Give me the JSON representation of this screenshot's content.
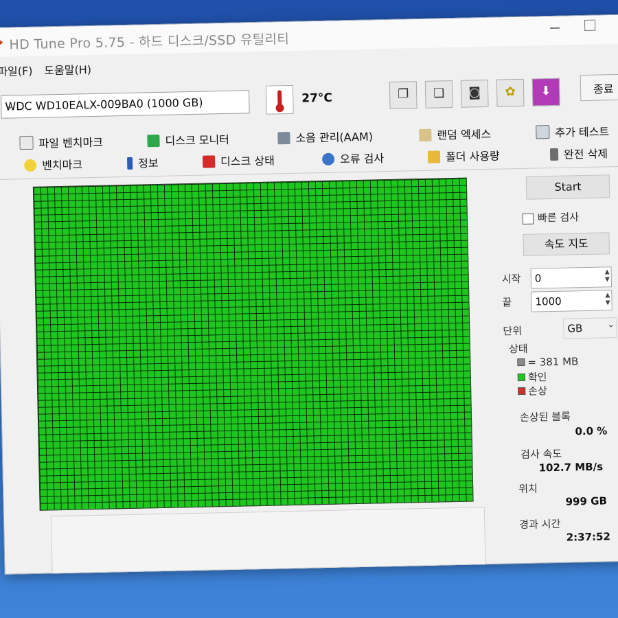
{
  "window": {
    "title": "HD Tune Pro 5.75 - 하드 디스크/SSD 유틸리티"
  },
  "menu": [
    {
      "label": "파일(F)"
    },
    {
      "label": "도움말(H)"
    }
  ],
  "device": {
    "selected": "WDC WD10EALX-009BA0 (1000 GB)"
  },
  "temperature": "27°C",
  "toolbar": {
    "icons": [
      "copy-info-icon",
      "copy-text-icon",
      "screenshot-icon",
      "options-icon",
      "save-icon"
    ],
    "exit_label": "종료"
  },
  "tabs_row1": [
    {
      "label": "파일 벤치마크",
      "icon": "file-benchmark-icon"
    },
    {
      "label": "디스크 모니터",
      "icon": "disk-monitor-icon"
    },
    {
      "label": "소음 관리(AAM)",
      "icon": "speaker-icon"
    },
    {
      "label": "랜덤 엑세스",
      "icon": "random-access-icon"
    },
    {
      "label": "추가 테스트",
      "icon": "extra-tests-icon"
    }
  ],
  "tabs_row2": [
    {
      "label": "벤치마크",
      "icon": "lightbulb-icon"
    },
    {
      "label": "정보",
      "icon": "info-icon"
    },
    {
      "label": "디스크 상태",
      "icon": "health-cross-icon"
    },
    {
      "label": "오류 검사",
      "icon": "magnifier-icon"
    },
    {
      "label": "폴더 사용량",
      "icon": "folder-icon"
    },
    {
      "label": "완전 삭제",
      "icon": "trash-icon"
    }
  ],
  "error_scan": {
    "start_label": "Start",
    "quick_scan_label": "빠른 검사",
    "speed_map_label": "속도 지도",
    "start_field_label": "시작",
    "start_value": "0",
    "end_field_label": "끝",
    "end_value": "1000",
    "unit_label": "단위",
    "unit_value": "GB",
    "status_label": "상태",
    "legend": [
      {
        "label": "= 381 MB",
        "color": "#8a8a8a"
      },
      {
        "label": "확인",
        "color": "#1fc61f"
      },
      {
        "label": "손상",
        "color": "#d23030"
      }
    ],
    "damaged_blocks_label": "손상된 블록",
    "damaged_blocks_value": "0.0 %",
    "scan_speed_label": "검사 속도",
    "scan_speed_value": "102.7 MB/s",
    "position_label": "위치",
    "position_value": "999 GB",
    "elapsed_label": "경과 시간",
    "elapsed_value": "2:37:52"
  },
  "colors": {
    "ok": "#1fc61f",
    "damaged": "#d23030",
    "grid": "#000000"
  }
}
